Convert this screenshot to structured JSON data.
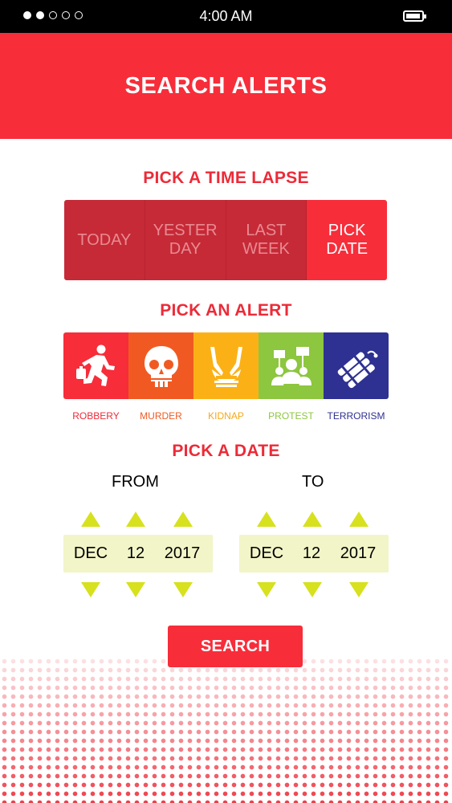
{
  "status_bar": {
    "time": "4:00 AM",
    "signal_dots": 5,
    "signal_filled": 2
  },
  "header": {
    "title": "SEARCH ALERTS"
  },
  "time_lapse": {
    "title": "PICK A TIME LAPSE",
    "options": [
      "TODAY",
      "YESTER\nDAY",
      "LAST\nWEEK",
      "PICK\nDATE"
    ],
    "selected": "PICK DATE"
  },
  "alerts": {
    "title": "PICK AN ALERT",
    "items": [
      {
        "label": "ROBBERY",
        "icon": "robbery-icon",
        "color": "#f72d3a",
        "label_color": "#ec2b38"
      },
      {
        "label": "MURDER",
        "icon": "skull-icon",
        "color": "#f05a22",
        "label_color": "#f05a22"
      },
      {
        "label": "KIDNAP",
        "icon": "tied-hands-icon",
        "color": "#fbb116",
        "label_color": "#f5a81a"
      },
      {
        "label": "PROTEST",
        "icon": "protest-icon",
        "color": "#8dc63f",
        "label_color": "#8dc63f"
      },
      {
        "label": "TERRORISM",
        "icon": "dynamite-icon",
        "color": "#2e3192",
        "label_color": "#2e3192"
      }
    ]
  },
  "date_picker": {
    "title": "PICK A DATE",
    "from": {
      "label": "FROM",
      "month": "DEC",
      "day": "12",
      "year": "2017"
    },
    "to": {
      "label": "TO",
      "month": "DEC",
      "day": "12",
      "year": "2017"
    }
  },
  "search_button": {
    "label": "SEARCH"
  },
  "colors": {
    "brand_red": "#f72d3a",
    "picker_bg": "#f2f5c7",
    "arrow": "#d7e11e"
  }
}
